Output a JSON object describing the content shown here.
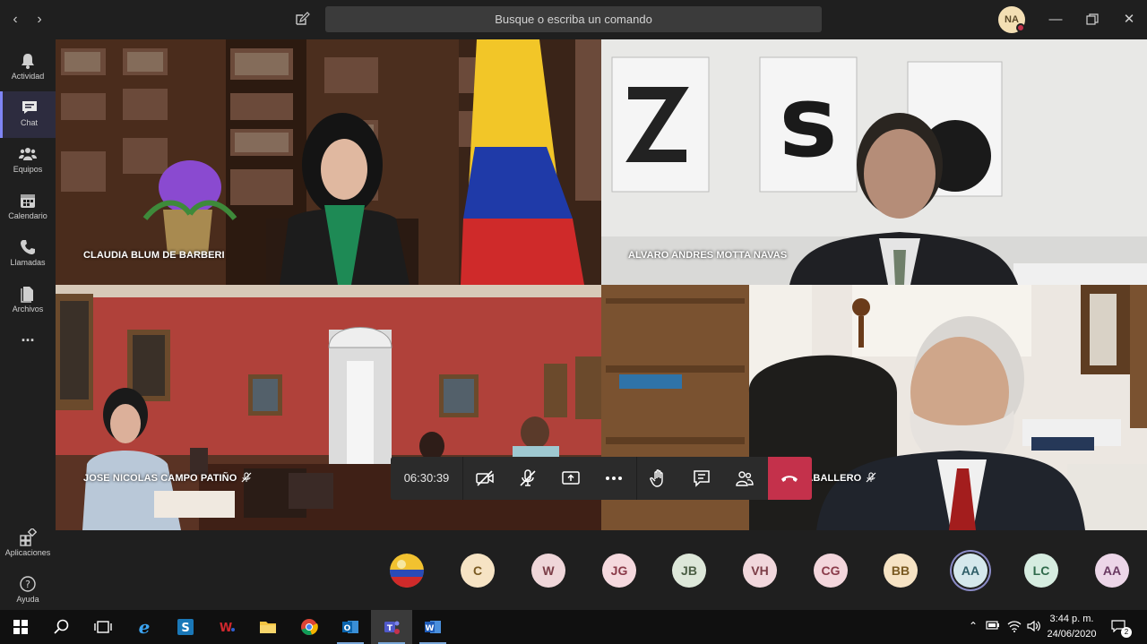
{
  "window": {
    "search_placeholder": "Busque o escriba un comando",
    "user_initials": "NA"
  },
  "rail": {
    "items": [
      {
        "label": "Actividad",
        "icon": "bell-icon"
      },
      {
        "label": "Chat",
        "icon": "chat-icon",
        "active": true
      },
      {
        "label": "Equipos",
        "icon": "teams-icon"
      },
      {
        "label": "Calendario",
        "icon": "calendar-icon"
      },
      {
        "label": "Llamadas",
        "icon": "phone-icon"
      },
      {
        "label": "Archivos",
        "icon": "files-icon"
      }
    ],
    "more": "...",
    "apps_label": "Aplicaciones",
    "help_label": "Ayuda"
  },
  "participants_video": [
    {
      "name": "CLAUDIA BLUM DE BARBERI",
      "muted": false
    },
    {
      "name": "ALVARO ANDRES MOTTA NAVAS",
      "muted": false
    },
    {
      "name": "JOSE NICOLAS CAMPO PATIÑO",
      "muted": true
    },
    {
      "name": "ALFONSO PEDRO LAZARO LOPEZ CABALLERO",
      "muted": true
    }
  ],
  "call": {
    "timer": "06:30:39"
  },
  "participant_strip": [
    {
      "initials": "",
      "bg": "#f2c230"
    },
    {
      "initials": "C",
      "bg": "#f6e3c4",
      "fg": "#7a5a22"
    },
    {
      "initials": "W",
      "bg": "#efd6d9",
      "fg": "#7b3d47"
    },
    {
      "initials": "JG",
      "bg": "#f5d9de",
      "fg": "#8a3b4a"
    },
    {
      "initials": "JB",
      "bg": "#dde7d9",
      "fg": "#4a5d43"
    },
    {
      "initials": "VH",
      "bg": "#f1d7dc",
      "fg": "#7b3d47"
    },
    {
      "initials": "CG",
      "bg": "#f3d6dc",
      "fg": "#8a3b4a"
    },
    {
      "initials": "BB",
      "bg": "#f6e3c4",
      "fg": "#7a5a22"
    },
    {
      "initials": "AA",
      "bg": "#d5e8ec",
      "fg": "#2f5e68",
      "active": true
    },
    {
      "initials": "LC",
      "bg": "#d6ece0",
      "fg": "#2f6a4b"
    },
    {
      "initials": "AA",
      "bg": "#ecd6e8",
      "fg": "#6a3a62"
    }
  ],
  "taskbar": {
    "time": "3:44 p. m.",
    "date": "24/06/2020",
    "notifications": "2"
  }
}
